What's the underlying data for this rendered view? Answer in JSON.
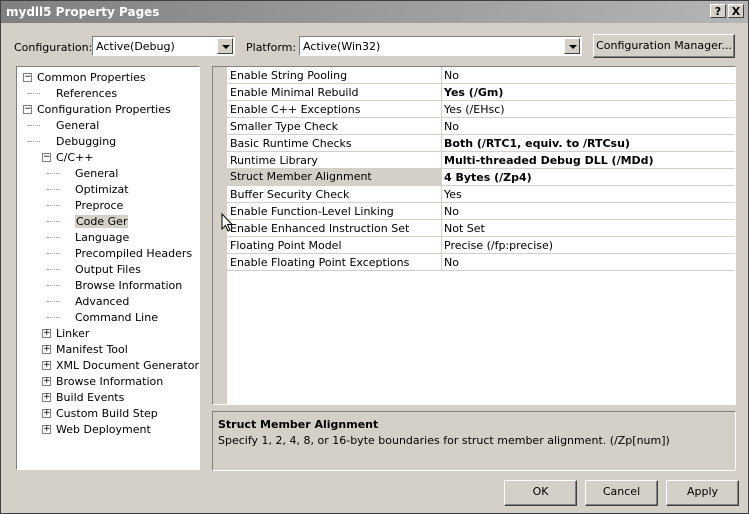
{
  "window": {
    "title": "mydll5 Property Pages",
    "help_glyph": "?",
    "close_glyph": "X"
  },
  "toolbar": {
    "configuration_label": "Configuration:",
    "configuration_value": "Active(Debug)",
    "platform_label": "Platform:",
    "platform_value": "Active(Win32)",
    "config_manager_label": "Configuration Manager..."
  },
  "tree": [
    {
      "label": "Common Properties",
      "level": 0,
      "toggle": "minus"
    },
    {
      "label": "References",
      "level": 1,
      "toggle": ""
    },
    {
      "label": "Configuration Properties",
      "level": 0,
      "toggle": "minus"
    },
    {
      "label": "General",
      "level": 1,
      "toggle": ""
    },
    {
      "label": "Debugging",
      "level": 1,
      "toggle": ""
    },
    {
      "label": "C/C++",
      "level": 1,
      "toggle": "minus"
    },
    {
      "label": "General",
      "level": 2,
      "toggle": ""
    },
    {
      "label": "Optimizat",
      "level": 2,
      "toggle": ""
    },
    {
      "label": "Preproce",
      "level": 2,
      "toggle": ""
    },
    {
      "label": "Code Ger",
      "level": 2,
      "toggle": "",
      "selected": true
    },
    {
      "label": "Language",
      "level": 2,
      "toggle": ""
    },
    {
      "label": "Precompiled Headers",
      "level": 2,
      "toggle": ""
    },
    {
      "label": "Output Files",
      "level": 2,
      "toggle": ""
    },
    {
      "label": "Browse Information",
      "level": 2,
      "toggle": ""
    },
    {
      "label": "Advanced",
      "level": 2,
      "toggle": ""
    },
    {
      "label": "Command Line",
      "level": 2,
      "toggle": ""
    },
    {
      "label": "Linker",
      "level": 1,
      "toggle": "plus"
    },
    {
      "label": "Manifest Tool",
      "level": 1,
      "toggle": "plus"
    },
    {
      "label": "XML Document Generator",
      "level": 1,
      "toggle": "plus"
    },
    {
      "label": "Browse Information",
      "level": 1,
      "toggle": "plus"
    },
    {
      "label": "Build Events",
      "level": 1,
      "toggle": "plus"
    },
    {
      "label": "Custom Build Step",
      "level": 1,
      "toggle": "plus"
    },
    {
      "label": "Web Deployment",
      "level": 1,
      "toggle": "plus"
    }
  ],
  "properties": [
    {
      "name": "Enable String Pooling",
      "value": "No",
      "bold": false
    },
    {
      "name": "Enable Minimal Rebuild",
      "value": "Yes (/Gm)",
      "bold": true
    },
    {
      "name": "Enable C++ Exceptions",
      "value": "Yes (/EHsc)",
      "bold": false
    },
    {
      "name": "Smaller Type Check",
      "value": "No",
      "bold": false
    },
    {
      "name": "Basic Runtime Checks",
      "value": "Both (/RTC1, equiv. to /RTCsu)",
      "bold": true
    },
    {
      "name": "Runtime Library",
      "value": "Multi-threaded Debug DLL (/MDd)",
      "bold": true
    },
    {
      "name": "Struct Member Alignment",
      "value": "4 Bytes (/Zp4)",
      "bold": true,
      "selected": true
    },
    {
      "name": "Buffer Security Check",
      "value": "Yes",
      "bold": false
    },
    {
      "name": "Enable Function-Level Linking",
      "value": "No",
      "bold": false
    },
    {
      "name": "Enable Enhanced Instruction Set",
      "value": "Not Set",
      "bold": false
    },
    {
      "name": "Floating Point Model",
      "value": "Precise (/fp:precise)",
      "bold": false
    },
    {
      "name": "Enable Floating Point Exceptions",
      "value": "No",
      "bold": false
    }
  ],
  "description": {
    "title": "Struct Member Alignment",
    "body": "Specify 1, 2, 4, 8, or 16-byte boundaries for struct member alignment.     (/Zp[num])"
  },
  "buttons": {
    "ok": "OK",
    "cancel": "Cancel",
    "apply": "Apply"
  }
}
